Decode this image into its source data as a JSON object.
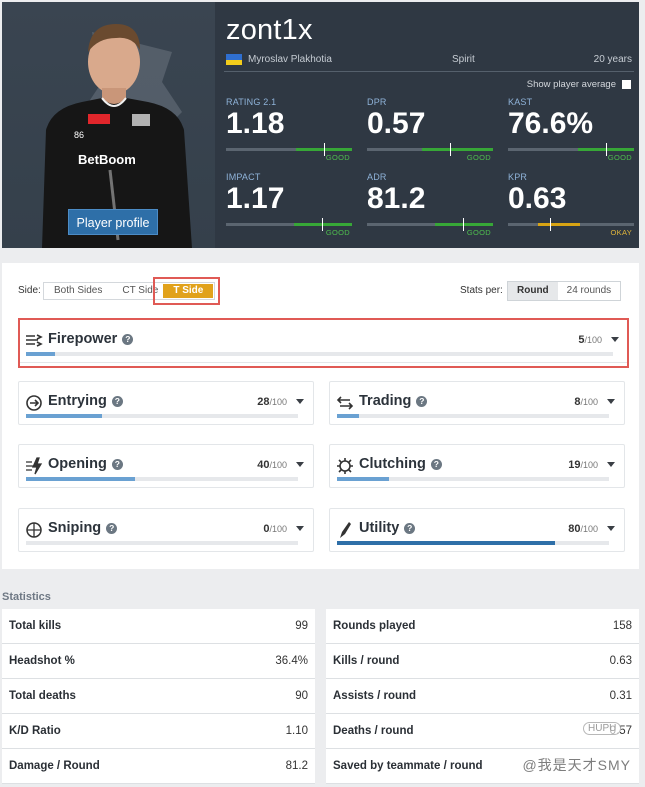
{
  "player": {
    "nickname": "zont1x",
    "real_name": "Myroslav Plakhotia",
    "team": "Spirit",
    "age": "20 years",
    "profile_button": "Player profile",
    "jersey_number": "86",
    "sponsor": "BetBoom",
    "show_average_label": "Show player average"
  },
  "header_stats": [
    {
      "label": "RATING 2.1",
      "value": "1.18",
      "rating": "GOOD",
      "level": 0.78
    },
    {
      "label": "DPR",
      "value": "0.57",
      "rating": "GOOD",
      "level": 0.66
    },
    {
      "label": "KAST",
      "value": "76.6%",
      "rating": "GOOD",
      "level": 0.78
    },
    {
      "label": "IMPACT",
      "value": "1.17",
      "rating": "GOOD",
      "level": 0.76
    },
    {
      "label": "ADR",
      "value": "81.2",
      "rating": "GOOD",
      "level": 0.76
    },
    {
      "label": "KPR",
      "value": "0.63",
      "rating": "OKAY",
      "level": 0.33
    }
  ],
  "filters": {
    "side_label": "Side:",
    "side_options": [
      "Both Sides",
      "CT Side",
      "T Side"
    ],
    "side_selected": "T Side",
    "stats_per_label": "Stats per:",
    "stats_per_options": [
      "Round",
      "24 rounds"
    ],
    "stats_per_selected": "Round"
  },
  "roles": [
    {
      "name": "Firepower",
      "score": "5",
      "max": "/100",
      "value": 5,
      "icon": "firepower-icon"
    },
    {
      "name": "Entrying",
      "score": "28",
      "max": "/100",
      "value": 28,
      "icon": "entrying-icon"
    },
    {
      "name": "Trading",
      "score": "8",
      "max": "/100",
      "value": 8,
      "icon": "trading-icon"
    },
    {
      "name": "Opening",
      "score": "40",
      "max": "/100",
      "value": 40,
      "icon": "opening-icon"
    },
    {
      "name": "Clutching",
      "score": "19",
      "max": "/100",
      "value": 19,
      "icon": "clutching-icon"
    },
    {
      "name": "Sniping",
      "score": "0",
      "max": "/100",
      "value": 0,
      "icon": "sniping-icon"
    },
    {
      "name": "Utility",
      "score": "80",
      "max": "/100",
      "value": 80,
      "icon": "utility-icon"
    }
  ],
  "statistics": {
    "title": "Statistics",
    "left": [
      {
        "label": "Total kills",
        "value": "99"
      },
      {
        "label": "Headshot %",
        "value": "36.4%"
      },
      {
        "label": "Total deaths",
        "value": "90"
      },
      {
        "label": "K/D Ratio",
        "value": "1.10"
      },
      {
        "label": "Damage / Round",
        "value": "81.2"
      }
    ],
    "right": [
      {
        "label": "Rounds played",
        "value": "158"
      },
      {
        "label": "Kills / round",
        "value": "0.63"
      },
      {
        "label": "Assists / round",
        "value": "0.31"
      },
      {
        "label": "Deaths / round",
        "value": "0.57"
      },
      {
        "label": "Saved by teammate / round",
        "value": ""
      }
    ]
  },
  "watermark": {
    "text": "@我是天才SMY",
    "logo": "HUPU"
  },
  "colors": {
    "header_bg": "#2f3843",
    "good": "#37a737",
    "okay": "#d8a414",
    "accent_blue": "#2e6fa8",
    "t_side": "#e1a21b",
    "highlight": "#e05a55",
    "role_bar": "#6aa1d2",
    "utility_bar": "#2e6fa8"
  }
}
